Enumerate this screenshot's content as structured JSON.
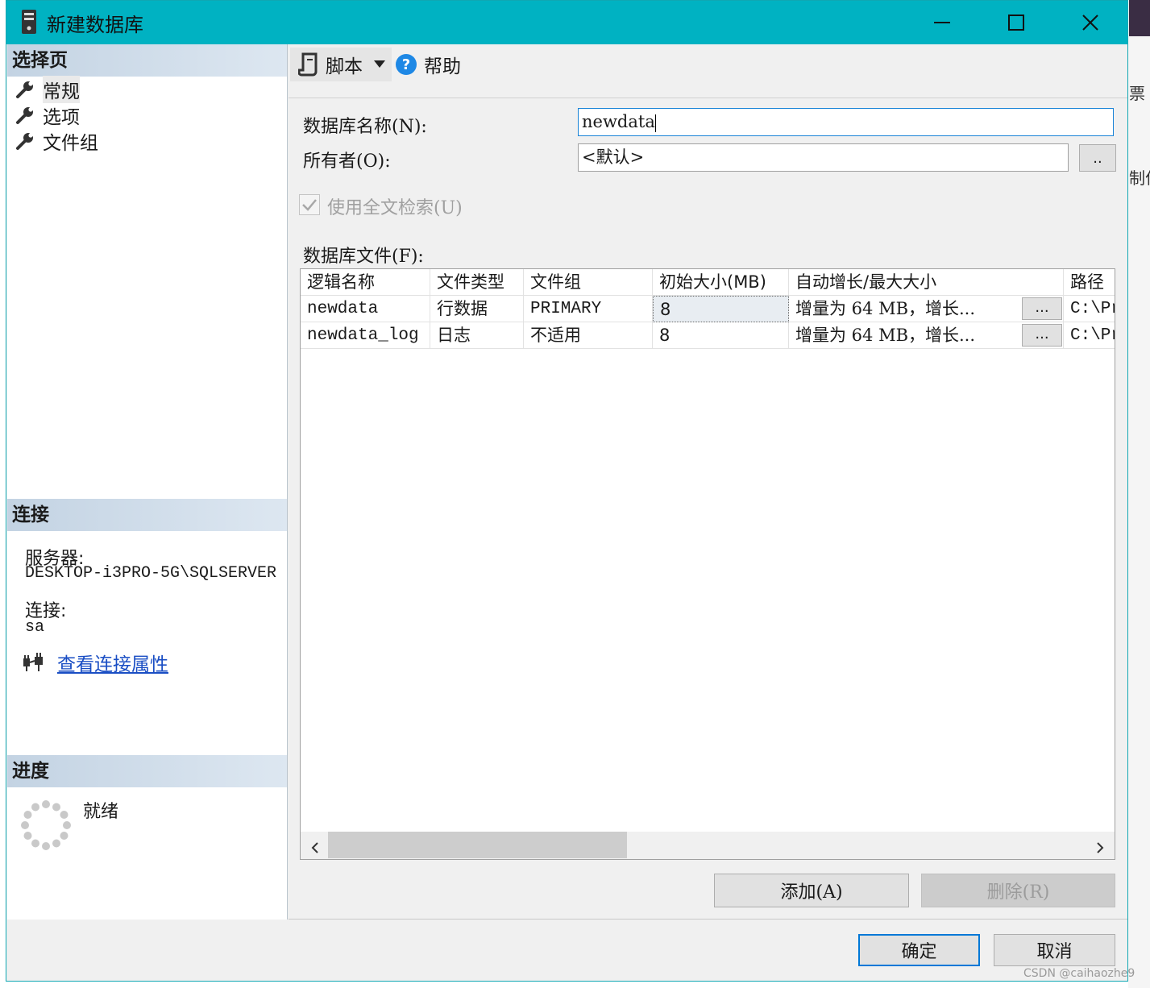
{
  "window": {
    "title": "新建数据库"
  },
  "left": {
    "select_page_header": "选择页",
    "pages": [
      {
        "label": "常规",
        "selected": true
      },
      {
        "label": "选项",
        "selected": false
      },
      {
        "label": "文件组",
        "selected": false
      }
    ],
    "connection_header": "连接",
    "server_label": "服务器:",
    "server_value": "DESKTOP-i3PRO-5G\\SQLSERVER",
    "connection_label": "连接:",
    "connection_value": "sa",
    "view_props_link": "查看连接属性",
    "progress_header": "进度",
    "progress_status": "就绪"
  },
  "toolbar": {
    "script_label": "脚本",
    "help_label": "帮助"
  },
  "form": {
    "db_name_label": "数据库名称(N):",
    "db_name_value": "newdata",
    "owner_label": "所有者(O):",
    "owner_value": "<默认>",
    "owner_browse": "..",
    "fulltext_label": "使用全文检索(U)",
    "fulltext_checked": true,
    "files_label": "数据库文件(F):"
  },
  "grid": {
    "columns": [
      "逻辑名称",
      "文件类型",
      "文件组",
      "初始大小(MB)",
      "自动增长/最大大小",
      "路径"
    ],
    "rows": [
      {
        "name": "newdata",
        "type": "行数据",
        "filegroup": "PRIMARY",
        "size": "8",
        "growth": "增量为 64 MB，增长...",
        "growth_btn": "...",
        "path": "C:\\Pr"
      },
      {
        "name": "newdata_log",
        "type": "日志",
        "filegroup": "不适用",
        "size": "8",
        "growth": "增量为 64 MB，增长...",
        "growth_btn": "...",
        "path": "C:\\Pr"
      }
    ]
  },
  "buttons": {
    "add": "添加(A)",
    "remove": "删除(R)",
    "ok": "确定",
    "cancel": "取消"
  },
  "background_fragments": {
    "right_top": "票",
    "right_mid": "制作"
  },
  "watermark": "CSDN @caihaozhe9",
  "colors": {
    "titlebar": "#00b2c2",
    "section_header": "#c8d7e6",
    "link": "#1a4ec4",
    "default_button_border": "#0078d7"
  }
}
